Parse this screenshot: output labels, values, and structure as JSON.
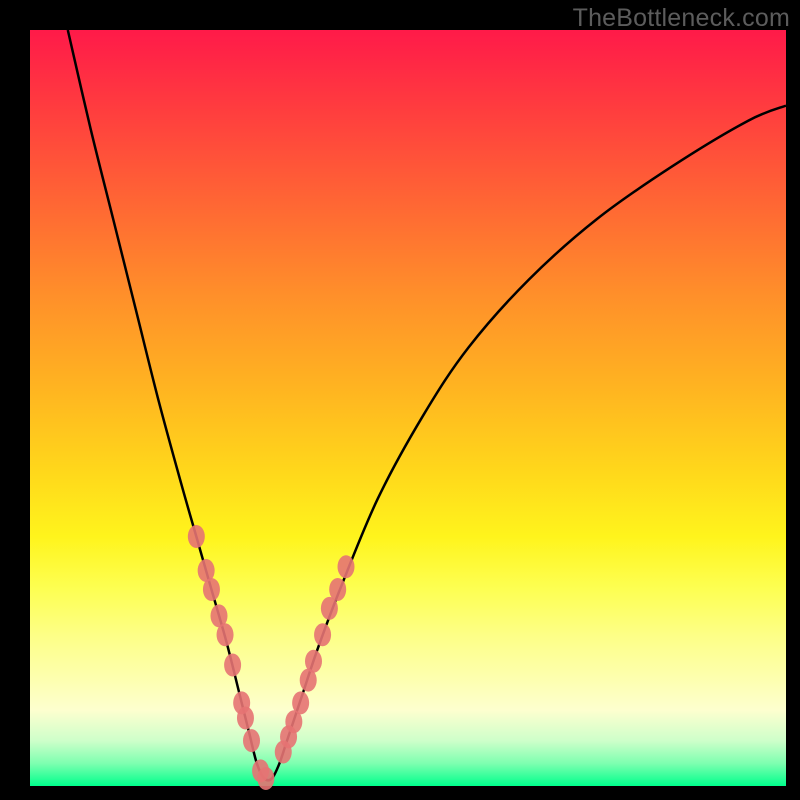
{
  "watermark": "TheBottleneck.com",
  "chart_data": {
    "type": "line",
    "title": "",
    "xlabel": "",
    "ylabel": "",
    "xlim": [
      0,
      100
    ],
    "ylim": [
      0,
      100
    ],
    "grid": false,
    "legend": false,
    "background_gradient": {
      "top_color": "#ff1a49",
      "bottom_color": "#00ff8c",
      "note": "red (top, high bottleneck) to green (bottom, optimal)"
    },
    "series": [
      {
        "name": "bottleneck-curve",
        "note": "V-shaped curve; y = estimated bottleneck % (lower is better), minimum near x≈31",
        "x": [
          5,
          8,
          11,
          14,
          17,
          20,
          22,
          24,
          26,
          28,
          29,
          30,
          31,
          32,
          33,
          34,
          36,
          38,
          41,
          46,
          52,
          58,
          66,
          75,
          85,
          95,
          100
        ],
        "y": [
          100,
          87,
          75,
          63,
          51,
          40,
          33,
          26,
          19,
          11,
          7,
          3,
          1,
          1,
          3,
          6,
          12,
          18,
          26,
          38,
          49,
          58,
          67,
          75,
          82,
          88,
          90
        ]
      },
      {
        "name": "sample-points-left-arm",
        "note": "salmon dots clustered on left descending arm",
        "x": [
          22.0,
          23.3,
          24.0,
          25.0,
          25.8,
          26.8,
          28.0,
          28.5,
          29.3,
          30.5,
          31.2
        ],
        "y": [
          33.0,
          28.5,
          26.0,
          22.5,
          20.0,
          16.0,
          11.0,
          9.0,
          6.0,
          2.0,
          1.0
        ]
      },
      {
        "name": "sample-points-right-arm",
        "note": "salmon dots clustered on right ascending arm",
        "x": [
          33.5,
          34.2,
          34.9,
          35.8,
          36.8,
          37.5,
          38.7,
          39.6,
          40.7,
          41.8
        ],
        "y": [
          4.5,
          6.5,
          8.5,
          11.0,
          14.0,
          16.5,
          20.0,
          23.5,
          26.0,
          29.0
        ]
      }
    ],
    "colors": {
      "curve": "#000000",
      "dots": "#e57373",
      "frame": "#000000"
    }
  }
}
